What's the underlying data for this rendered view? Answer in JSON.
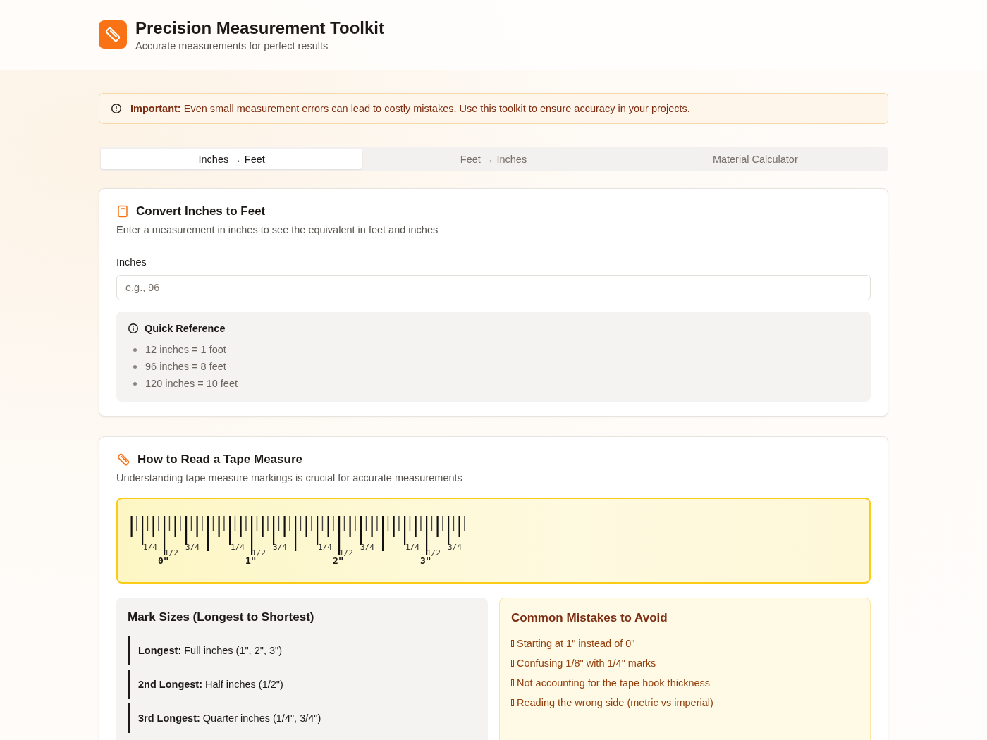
{
  "header": {
    "title": "Precision Measurement Toolkit",
    "subtitle": "Accurate measurements for perfect results"
  },
  "alert": {
    "text": "**Important:** Even small measurement errors can lead to costly mistakes. Use this toolkit to ensure accuracy in your projects."
  },
  "tabs": [
    {
      "label": "Inches → Feet",
      "selected": true
    },
    {
      "label": "Feet → Inches",
      "selected": false
    },
    {
      "label": "Material Calculator",
      "selected": false
    }
  ],
  "converter": {
    "title": "Convert Inches to Feet",
    "description": "Enter a measurement in inches to see the equivalent in feet and inches",
    "field_label": "Inches",
    "placeholder": "e.g., 96",
    "reference": {
      "title": "Quick Reference",
      "items": [
        "12 inches = 1 foot",
        "96 inches = 8 feet",
        "120 inches = 10 feet"
      ]
    }
  },
  "guide": {
    "title": "How to Read a Tape Measure",
    "description": "Understanding tape measure markings is crucial for accurate measurements",
    "ruler": [
      {
        "label": "0\"",
        "marks": [
          "1/4",
          "1/2",
          "3/4"
        ]
      },
      {
        "label": "1\"",
        "marks": [
          "1/4",
          "1/2",
          "3/4"
        ]
      },
      {
        "label": "2\"",
        "marks": [
          "1/4",
          "1/2",
          "3/4"
        ]
      },
      {
        "label": "3\"",
        "marks": [
          "1/4",
          "1/2",
          "3/4"
        ]
      }
    ],
    "mark_sizes": {
      "title": "Mark Sizes (Longest to Shortest)",
      "items": [
        "**Longest:** Full inches (1\", 2\", 3\")",
        "**2nd Longest:** Half inches (1/2\")",
        "**3rd Longest:** Quarter inches (1/4\", 3/4\")"
      ]
    },
    "mistakes": {
      "title": "Common Mistakes to Avoid",
      "items": [
        "Starting at 1\" instead of 0\"",
        "Confusing 1/8\" with 1/4\" marks",
        "Not accounting for the tape hook thickness",
        "Reading the wrong side (metric vs imperial)"
      ]
    }
  }
}
